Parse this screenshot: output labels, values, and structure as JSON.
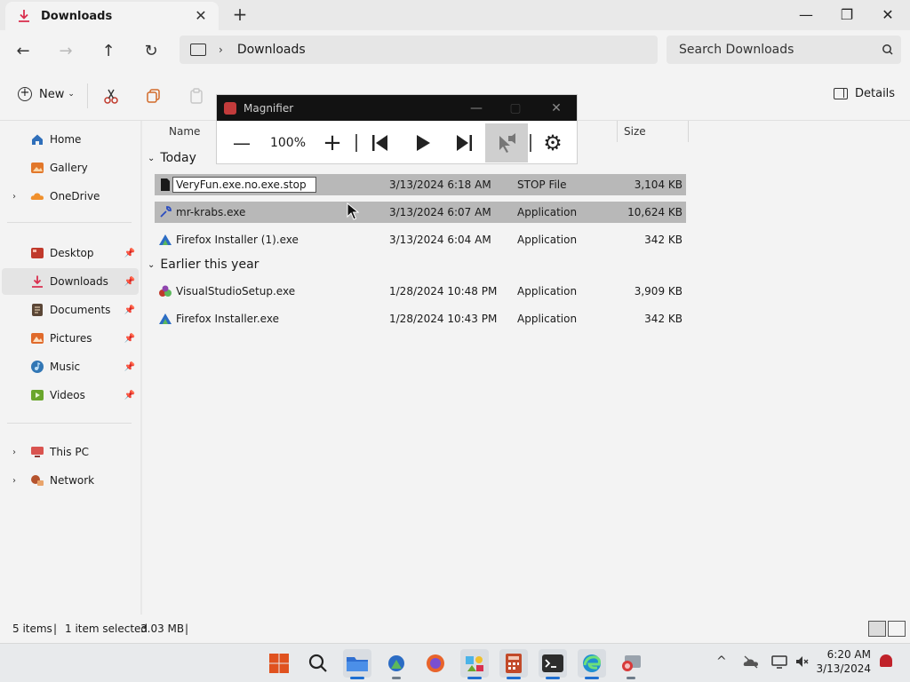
{
  "window": {
    "tab_title": "Downloads",
    "tab_close": "✕",
    "new_tab": "+",
    "minimize": "—",
    "maximize": "❐",
    "close": "✕"
  },
  "nav": {
    "back": "←",
    "forward": "→",
    "up": "↑",
    "refresh": "↻",
    "breadcrumb_chevron": "›",
    "current_path": "Downloads",
    "search_placeholder": "Search Downloads",
    "search_icon": "search-icon"
  },
  "commandbar": {
    "new_label": "New",
    "new_caret": "⌄",
    "details_label": "Details"
  },
  "sidebar": {
    "items": [
      {
        "label": "Home",
        "color": "#2f6fba"
      },
      {
        "label": "Gallery",
        "color": "#e2772a"
      },
      {
        "label": "OneDrive",
        "color": "#f0902c"
      },
      {
        "label": "Desktop",
        "color": "#c0392b"
      },
      {
        "label": "Downloads",
        "color": "#d9304f"
      },
      {
        "label": "Documents",
        "color": "#5a4636"
      },
      {
        "label": "Pictures",
        "color": "#e06a2b"
      },
      {
        "label": "Music",
        "color": "#3277b5"
      },
      {
        "label": "Videos",
        "color": "#6aa62c"
      },
      {
        "label": "This PC",
        "color": "#d9534f"
      },
      {
        "label": "Network",
        "color": "#b5532d"
      }
    ],
    "pin": "📌",
    "expand": "›"
  },
  "columns": {
    "name": "Name",
    "size": "Size"
  },
  "groups": {
    "today": "Today",
    "earlier": "Earlier this year",
    "chevron": "⌄"
  },
  "files": [
    {
      "name": "VeryFun.exe.no.exe.stop",
      "date": "3/13/2024 6:18 AM",
      "type": "STOP File",
      "size": "3,104 KB"
    },
    {
      "name": "mr-krabs.exe",
      "date": "3/13/2024 6:07 AM",
      "type": "Application",
      "size": "10,624 KB"
    },
    {
      "name": "Firefox Installer (1).exe",
      "date": "3/13/2024 6:04 AM",
      "type": "Application",
      "size": "342 KB"
    },
    {
      "name": "VisualStudioSetup.exe",
      "date": "1/28/2024 10:48 PM",
      "type": "Application",
      "size": "3,909 KB"
    },
    {
      "name": "Firefox Installer.exe",
      "date": "1/28/2024 10:43 PM",
      "type": "Application",
      "size": "342 KB"
    }
  ],
  "status": {
    "items": "5 items",
    "selected": "1 item selected",
    "size": "3.03 MB",
    "sep": "|"
  },
  "magnifier": {
    "title": "Magnifier",
    "minimize": "—",
    "close": "✕",
    "zoom_out": "—",
    "zoom_level": "100%",
    "zoom_in": "+",
    "settings": "⚙"
  },
  "taskbar": {
    "time": "6:20 AM",
    "date": "3/13/2024",
    "tray_chevron": "^"
  }
}
